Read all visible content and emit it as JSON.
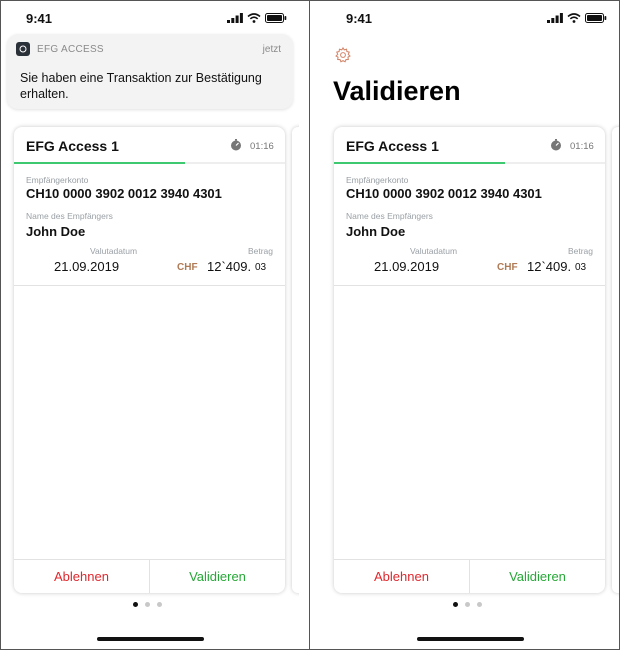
{
  "status_bar": {
    "time": "9:41"
  },
  "notification": {
    "app_name": "EFG ACCESS",
    "time": "jetzt",
    "message": "Sie haben eine Transaktion zur Bestätigung erhalten."
  },
  "page": {
    "title": "Validieren"
  },
  "card": {
    "title": "EFG Access 1",
    "timer": "01:16",
    "timer_progress": 0.63,
    "account_label": "Empfängerkonto",
    "account_value": "CH10 0000 3902 0012 3940 4301",
    "recipient_label": "Name des Empfängers",
    "recipient_value": "John Doe",
    "value_date_label": "Valutadatum",
    "value_date": "21.09.2019",
    "amount_label": "Betrag",
    "currency": "CHF",
    "amount_main": "12`409.",
    "amount_cents": "03",
    "reject_label": "Ablehnen",
    "accept_label": "Validieren"
  },
  "pagination": {
    "count": 3,
    "active": 0
  },
  "colors": {
    "accept": "#27a737",
    "reject": "#e0282e",
    "currency": "#b07a55",
    "progress": "#3ec86f",
    "gear": "#d4866a"
  }
}
